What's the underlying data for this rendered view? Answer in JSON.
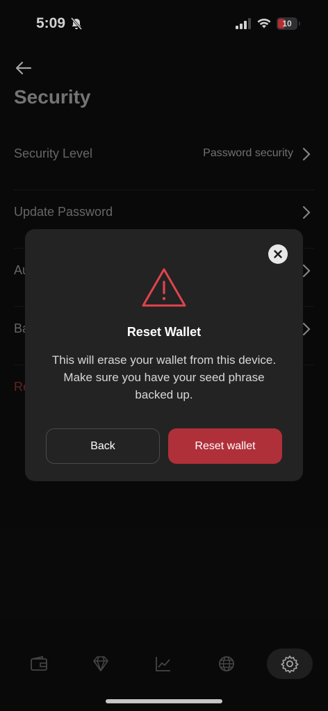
{
  "status_bar": {
    "time": "5:09",
    "battery": "10"
  },
  "header": {
    "title": "Security"
  },
  "rows": [
    {
      "label": "Security Level",
      "value": "Password security"
    },
    {
      "label": "Update Password",
      "value": ""
    },
    {
      "label": "Au",
      "value": ""
    },
    {
      "label": "Ba",
      "value": ""
    },
    {
      "label": "Re",
      "value": ""
    }
  ],
  "modal": {
    "title": "Reset Wallet",
    "message": "This will erase your wallet from this device. Make sure you have your seed phrase backed up.",
    "back_label": "Back",
    "reset_label": "Reset wallet"
  },
  "tabs": [
    "wallet-icon",
    "diamond-icon",
    "chart-icon",
    "globe-icon",
    "gear-icon"
  ],
  "colors": {
    "accent_red": "#b0303a",
    "background": "#0c0c0c",
    "modal_bg": "#232323"
  }
}
